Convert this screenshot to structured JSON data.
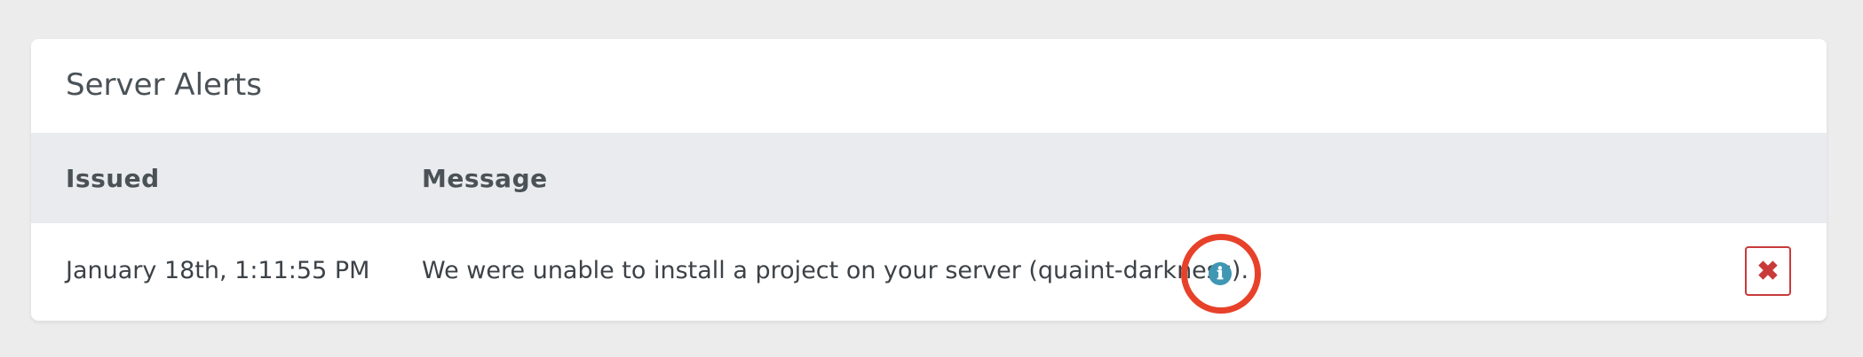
{
  "panel": {
    "title": "Server Alerts"
  },
  "table": {
    "columns": [
      "Issued",
      "Message"
    ],
    "rows": [
      {
        "issued": "January 18th, 1:11:55 PM",
        "message": "We were unable to install a project on your server (quaint-darkness).",
        "info_icon": "info-circle-icon",
        "dismiss_icon": "close-icon"
      }
    ]
  },
  "colors": {
    "background": "#ececed",
    "header_row": "#e9ebee",
    "info_icon": "#3f97b3",
    "dismiss_button": "#c93a3a",
    "highlight_ring": "#e8412a"
  },
  "icons": {
    "info": "ℹ",
    "dismiss": "✖"
  }
}
